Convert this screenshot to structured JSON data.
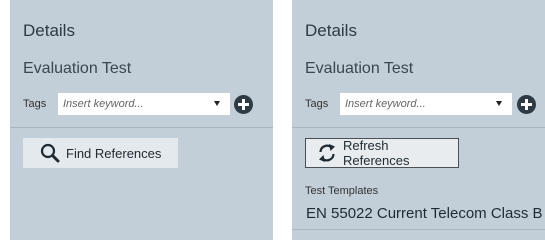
{
  "panels": [
    {
      "title": "Details",
      "subtitle": "Evaluation Test",
      "tags_label": "Tags",
      "tags_placeholder": "Insert keyword...",
      "action_label": "Find References"
    },
    {
      "title": "Details",
      "subtitle": "Evaluation Test",
      "tags_label": "Tags",
      "tags_placeholder": "Insert keyword...",
      "action_label": "Refresh References",
      "section_label": "Test Templates",
      "templates": [
        "EN 55022 Current Telecom Class B"
      ]
    }
  ],
  "icons": {
    "add": "plus-circle-icon",
    "find": "magnifier-icon",
    "refresh": "refresh-arrows-icon",
    "dropdown": "caret-down-icon"
  },
  "colors": {
    "panel_bg": "#c2ced8",
    "button_bg": "#e4e9ed",
    "add_icon": "#2f3b44"
  }
}
